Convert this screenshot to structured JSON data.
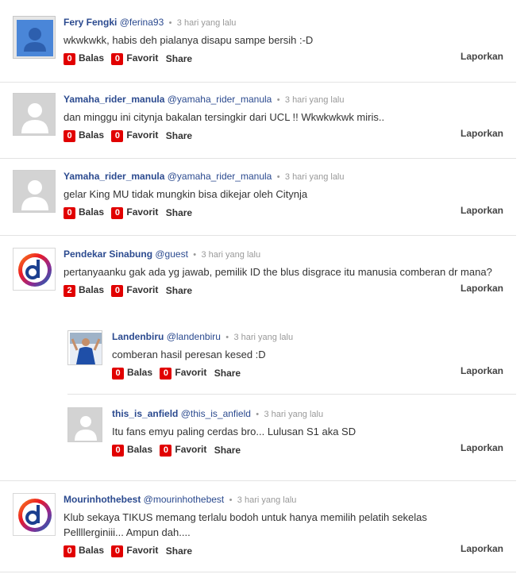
{
  "labels": {
    "reply": "Balas",
    "favorite": "Favorit",
    "share": "Share",
    "report": "Laporkan",
    "separator": "•"
  },
  "comments": [
    {
      "name": "Fery Fengki",
      "handle": "@ferina93",
      "time": "3 hari yang lalu",
      "text": "wkwkwkk, habis deh pialanya disapu sampe bersih :-D",
      "reply_count": "0",
      "fav_count": "0",
      "avatar_icon": "blue-user-silhouette-icon"
    },
    {
      "name": "Yamaha_rider_manula",
      "handle": "@yamaha_rider_manula",
      "time": "3 hari yang lalu",
      "text": "dan minggu ini citynja bakalan tersingkir dari UCL !! Wkwkwkwk miris..",
      "reply_count": "0",
      "fav_count": "0",
      "avatar_icon": "default-user-icon"
    },
    {
      "name": "Yamaha_rider_manula",
      "handle": "@yamaha_rider_manula",
      "time": "3 hari yang lalu",
      "text": "gelar King MU tidak mungkin bisa dikejar oleh Citynja",
      "reply_count": "0",
      "fav_count": "0",
      "avatar_icon": "default-user-icon"
    },
    {
      "name": "Pendekar Sinabung",
      "handle": "@guest",
      "time": "3 hari yang lalu",
      "text": "pertanyaanku gak ada yg jawab, pemilik ID the blus disgrace itu manusia comberan dr mana?",
      "reply_count": "2",
      "fav_count": "0",
      "avatar_icon": "detik-logo-icon"
    },
    {
      "name": "Mourinhothebest",
      "handle": "@mourinhothebest",
      "time": "3 hari yang lalu",
      "text": "Klub sekaya TIKUS memang terlalu bodoh untuk hanya memilih pelatih sekelas Pellllerginiii... Ampun dah....",
      "reply_count": "0",
      "fav_count": "0",
      "avatar_icon": "detik-logo-icon"
    }
  ],
  "replies": [
    {
      "name": "Landenbiru",
      "handle": "@landenbiru",
      "time": "3 hari yang lalu",
      "text": "comberan hasil peresan kesed :D",
      "reply_count": "0",
      "fav_count": "0",
      "avatar_icon": "photo-avatar-icon"
    },
    {
      "name": "this_is_anfield",
      "handle": "@this_is_anfield",
      "time": "3 hari yang lalu",
      "text": "Itu fans emyu paling cerdas bro... Lulusan S1 aka SD",
      "reply_count": "0",
      "fav_count": "0",
      "avatar_icon": "default-user-icon"
    }
  ]
}
